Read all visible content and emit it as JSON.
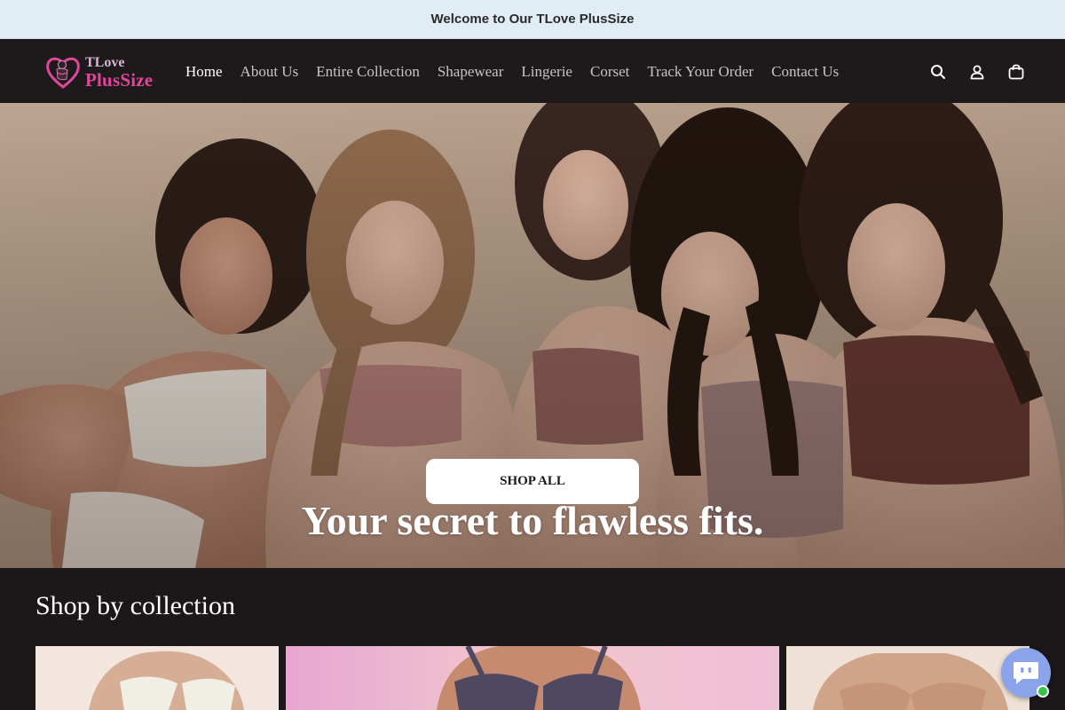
{
  "announcement": {
    "text": "Welcome to Our TLove PlusSize"
  },
  "header": {
    "logo": {
      "line1": "TLove",
      "line2": "PlusSize"
    },
    "nav": [
      {
        "label": "Home",
        "active": true
      },
      {
        "label": "About Us"
      },
      {
        "label": "Entire Collection"
      },
      {
        "label": "Shapewear"
      },
      {
        "label": "Lingerie"
      },
      {
        "label": "Corset"
      },
      {
        "label": "Track Your Order"
      },
      {
        "label": "Contact Us"
      }
    ],
    "icons": [
      "search-icon",
      "account-icon",
      "cart-icon"
    ]
  },
  "hero": {
    "title": "Your secret to flawless fits.",
    "button_label": "SHOP ALL"
  },
  "collections": {
    "heading": "Shop by collection"
  },
  "chat": {
    "icon": "chat-bot-icon",
    "status_color": "#37c24a"
  },
  "colors": {
    "brand_pink": "#e0479a",
    "header_bg": "#1e1a1b",
    "announcement_bg": "#e1edf5"
  }
}
